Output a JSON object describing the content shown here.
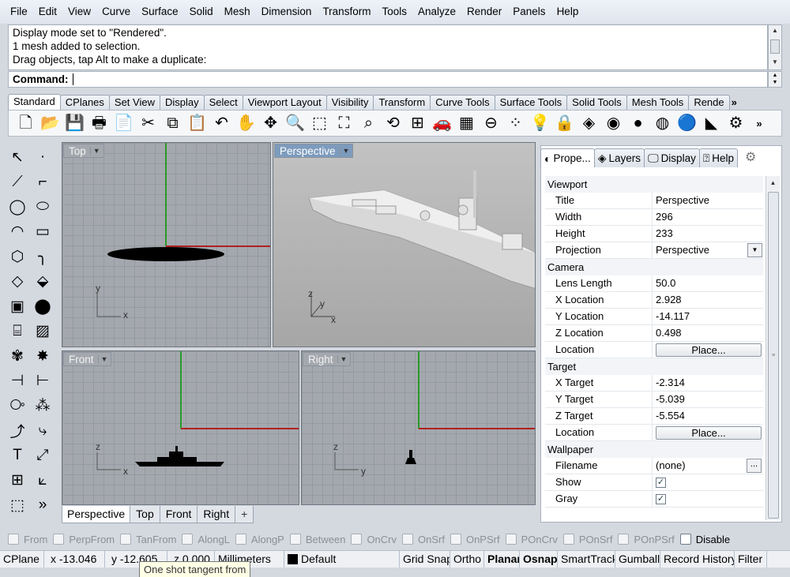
{
  "menu": [
    "File",
    "Edit",
    "View",
    "Curve",
    "Surface",
    "Solid",
    "Mesh",
    "Dimension",
    "Transform",
    "Tools",
    "Analyze",
    "Render",
    "Panels",
    "Help"
  ],
  "command_history": [
    "Display mode set to \"Rendered\".",
    "1 mesh added to selection.",
    "Drag objects, tap Alt to make a duplicate:"
  ],
  "command_prompt": "Command:",
  "toolbar_tabs": [
    "Standard",
    "CPlanes",
    "Set View",
    "Display",
    "Select",
    "Viewport Layout",
    "Visibility",
    "Transform",
    "Curve Tools",
    "Surface Tools",
    "Solid Tools",
    "Mesh Tools",
    "Rende"
  ],
  "toolbar_more": "»",
  "toolbar_icons": [
    {
      "name": "new-file-icon",
      "glyph": "🗋"
    },
    {
      "name": "open-folder-icon",
      "glyph": "📂"
    },
    {
      "name": "save-icon",
      "glyph": "💾"
    },
    {
      "name": "print-icon",
      "glyph": "🖶"
    },
    {
      "name": "import-icon",
      "glyph": "📄"
    },
    {
      "name": "cut-icon",
      "glyph": "✂"
    },
    {
      "name": "copy-icon",
      "glyph": "⧉"
    },
    {
      "name": "paste-icon",
      "glyph": "📋"
    },
    {
      "name": "undo-icon",
      "glyph": "↶"
    },
    {
      "name": "pan-hand-icon",
      "glyph": "✋"
    },
    {
      "name": "rotate-view-icon",
      "glyph": "✥"
    },
    {
      "name": "zoom-icon",
      "glyph": "🔍"
    },
    {
      "name": "zoom-window-icon",
      "glyph": "⬚"
    },
    {
      "name": "zoom-extents-icon",
      "glyph": "⛶"
    },
    {
      "name": "zoom-selected-icon",
      "glyph": "⌕"
    },
    {
      "name": "undo-view-icon",
      "glyph": "⟲"
    },
    {
      "name": "four-viewports-icon",
      "glyph": "⊞"
    },
    {
      "name": "car-icon",
      "glyph": "🚗"
    },
    {
      "name": "grid-plane-icon",
      "glyph": "▦"
    },
    {
      "name": "tangent-icon",
      "glyph": "⊖"
    },
    {
      "name": "points-icon",
      "glyph": "⁘"
    },
    {
      "name": "lightbulb-icon",
      "glyph": "💡"
    },
    {
      "name": "lock-icon",
      "glyph": "🔒"
    },
    {
      "name": "layers-icon",
      "glyph": "◈"
    },
    {
      "name": "color-wheel-icon",
      "glyph": "◉"
    },
    {
      "name": "material-ball-icon",
      "glyph": "●"
    },
    {
      "name": "render-sphere-icon",
      "glyph": "◍"
    },
    {
      "name": "render-blue-icon",
      "glyph": "🔵"
    },
    {
      "name": "spotlight-icon",
      "glyph": "◣"
    },
    {
      "name": "options-gear-icon",
      "glyph": "⚙"
    }
  ],
  "left_tools": [
    {
      "name": "select-arrow-icon",
      "glyph": "↖"
    },
    {
      "name": "point-icon",
      "glyph": "·"
    },
    {
      "name": "polyline-icon",
      "glyph": "⟋"
    },
    {
      "name": "curve-cv-icon",
      "glyph": "⌐"
    },
    {
      "name": "circle-icon",
      "glyph": "◯"
    },
    {
      "name": "ellipse-icon",
      "glyph": "⬭"
    },
    {
      "name": "arc-icon",
      "glyph": "◠"
    },
    {
      "name": "rectangle-icon",
      "glyph": "▭"
    },
    {
      "name": "polygon-icon",
      "glyph": "⬡"
    },
    {
      "name": "fillet-curve-icon",
      "glyph": "╮"
    },
    {
      "name": "surface-points-icon",
      "glyph": "◇"
    },
    {
      "name": "surface-edge-icon",
      "glyph": "⬙"
    },
    {
      "name": "box-solid-icon",
      "glyph": "▣"
    },
    {
      "name": "sphere-solid-icon",
      "glyph": "⬤"
    },
    {
      "name": "cylinder-icon",
      "glyph": "⌸"
    },
    {
      "name": "mesh-plane-icon",
      "glyph": "▨"
    },
    {
      "name": "array-gear-icon",
      "glyph": "✾"
    },
    {
      "name": "explode-icon",
      "glyph": "✸"
    },
    {
      "name": "trim-icon",
      "glyph": "⊣"
    },
    {
      "name": "split-icon",
      "glyph": "⊢"
    },
    {
      "name": "boolean-icon",
      "glyph": "⧂"
    },
    {
      "name": "points-group-icon",
      "glyph": "⁂"
    },
    {
      "name": "offset-curve-icon",
      "glyph": "⤴"
    },
    {
      "name": "blend-curve-icon",
      "glyph": "⤷"
    },
    {
      "name": "text-icon",
      "glyph": "T"
    },
    {
      "name": "scale-icon",
      "glyph": "⤢"
    },
    {
      "name": "grid-array-icon",
      "glyph": "⊞"
    },
    {
      "name": "dimension-icon",
      "glyph": "⟀"
    },
    {
      "name": "cube-view-icon",
      "glyph": "⬚"
    },
    {
      "name": "more-tools-icon",
      "glyph": "»"
    }
  ],
  "viewports": {
    "top": {
      "label": "Top"
    },
    "perspective": {
      "label": "Perspective"
    },
    "front": {
      "label": "Front"
    },
    "right": {
      "label": "Right"
    }
  },
  "axis": {
    "x": "x",
    "y": "y",
    "z": "z"
  },
  "viewport_tabs": [
    "Perspective",
    "Top",
    "Front",
    "Right"
  ],
  "viewport_tab_add": "+",
  "panel_tabs": [
    {
      "label": "Prope...",
      "icon": "properties-icon",
      "glyph": "◐"
    },
    {
      "label": "Layers",
      "icon": "layers-icon",
      "glyph": "◈"
    },
    {
      "label": "Display",
      "icon": "display-monitor-icon",
      "glyph": "🖵"
    },
    {
      "label": "Help",
      "icon": "help-icon",
      "glyph": "⍰"
    }
  ],
  "properties": {
    "viewport": {
      "heading": "Viewport",
      "rows": [
        {
          "key": "Title",
          "value": "Perspective"
        },
        {
          "key": "Width",
          "value": "296"
        },
        {
          "key": "Height",
          "value": "233"
        },
        {
          "key": "Projection",
          "value": "Perspective"
        }
      ]
    },
    "camera": {
      "heading": "Camera",
      "rows": [
        {
          "key": "Lens Length",
          "value": "50.0"
        },
        {
          "key": "X Location",
          "value": "2.928"
        },
        {
          "key": "Y Location",
          "value": "-14.117"
        },
        {
          "key": "Z Location",
          "value": "0.498"
        },
        {
          "key": "Location",
          "value": "Place..."
        }
      ]
    },
    "target": {
      "heading": "Target",
      "rows": [
        {
          "key": "X Target",
          "value": "-2.314"
        },
        {
          "key": "Y Target",
          "value": "-5.039"
        },
        {
          "key": "Z Target",
          "value": "-5.554"
        },
        {
          "key": "Location",
          "value": "Place..."
        }
      ]
    },
    "wallpaper": {
      "heading": "Wallpaper",
      "rows": [
        {
          "key": "Filename",
          "value": "(none)",
          "button": "..."
        },
        {
          "key": "Show",
          "checked": true
        },
        {
          "key": "Gray",
          "checked": true
        }
      ]
    }
  },
  "osnaps": [
    {
      "label": "From",
      "on": false
    },
    {
      "label": "PerpFrom",
      "on": false
    },
    {
      "label": "TanFrom",
      "on": false
    },
    {
      "label": "AlongL",
      "on": false
    },
    {
      "label": "AlongP",
      "on": false
    },
    {
      "label": "Between",
      "on": false
    },
    {
      "label": "OnCrv",
      "on": false
    },
    {
      "label": "OnSrf",
      "on": false
    },
    {
      "label": "OnPSrf",
      "on": false
    },
    {
      "label": "POnCrv",
      "on": false
    },
    {
      "label": "POnSrf",
      "on": false
    },
    {
      "label": "POnPSrf",
      "on": false
    },
    {
      "label": "Disable",
      "on": true
    }
  ],
  "status": {
    "cplane": "CPlane",
    "x": "x -13.046",
    "y": "y -12.605",
    "z": "z 0.000",
    "units": "Millimeters",
    "layer": "Default",
    "grid_snap": "Grid Snap",
    "ortho": "Ortho",
    "planar": "Planar",
    "osnap": "Osnap",
    "smarttrack": "SmartTrack",
    "gumball": "Gumball",
    "record_history": "Record History",
    "filter": "Filter"
  },
  "tooltip": "One shot tangent from",
  "colors": {
    "x_axis": "#b02020",
    "y_axis": "#2a9a2a",
    "viewport_bg": "#a4a8ae",
    "persp_label": "#7d9bbd"
  }
}
